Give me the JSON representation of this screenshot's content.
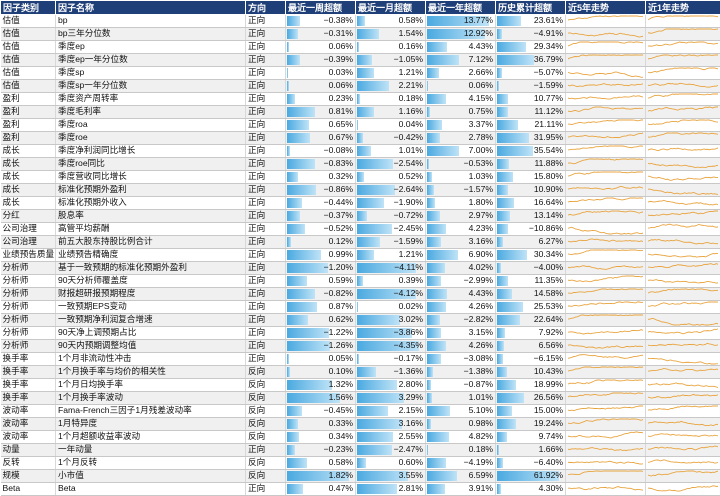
{
  "headers": [
    "因子类别",
    "因子名称",
    "方向",
    "最近一周超额",
    "最近一月超额",
    "最近一年超额",
    "历史累计超额",
    "近5年走势",
    "近1年走势"
  ],
  "colors": {
    "header_bg": "#1f3f78",
    "bar": "#4aa9e0",
    "spark": "#e8a33d"
  },
  "rows": [
    {
      "cat": "估值",
      "name": "bp",
      "dir": "正向",
      "w": -0.38,
      "m": 0.58,
      "y": 13.77,
      "h": 23.61
    },
    {
      "cat": "估值",
      "name": "bp三年分位数",
      "dir": "正向",
      "w": -0.31,
      "m": 1.54,
      "y": 12.92,
      "h": -4.91
    },
    {
      "cat": "估值",
      "name": "季度ep",
      "dir": "正向",
      "w": 0.06,
      "m": 0.16,
      "y": 4.43,
      "h": 29.34
    },
    {
      "cat": "估值",
      "name": "季度ep一年分位数",
      "dir": "正向",
      "w": -0.39,
      "m": -1.05,
      "y": 7.12,
      "h": 36.79
    },
    {
      "cat": "估值",
      "name": "季度sp",
      "dir": "正向",
      "w": 0.03,
      "m": 1.21,
      "y": 2.66,
      "h": -5.07
    },
    {
      "cat": "估值",
      "name": "季度sp一年分位数",
      "dir": "正向",
      "w": 0.06,
      "m": 2.21,
      "y": 0.06,
      "h": -1.59
    },
    {
      "cat": "盈利",
      "name": "季度资产周转率",
      "dir": "正向",
      "w": 0.23,
      "m": 0.18,
      "y": 4.15,
      "h": 10.77
    },
    {
      "cat": "盈利",
      "name": "季度毛利率",
      "dir": "正向",
      "w": 0.81,
      "m": 1.16,
      "y": 0.75,
      "h": 11.12
    },
    {
      "cat": "盈利",
      "name": "季度roa",
      "dir": "正向",
      "w": 0.65,
      "m": 0.04,
      "y": 3.37,
      "h": 21.11
    },
    {
      "cat": "盈利",
      "name": "季度roe",
      "dir": "正向",
      "w": 0.67,
      "m": -0.42,
      "y": 2.78,
      "h": 31.95
    },
    {
      "cat": "成长",
      "name": "季度净利润同比增长",
      "dir": "正向",
      "w": -0.08,
      "m": 1.01,
      "y": 7.0,
      "h": 35.54
    },
    {
      "cat": "成长",
      "name": "季度roe同比",
      "dir": "正向",
      "w": -0.83,
      "m": -2.54,
      "y": -0.53,
      "h": 11.88
    },
    {
      "cat": "成长",
      "name": "季度营收同比增长",
      "dir": "正向",
      "w": 0.32,
      "m": 0.52,
      "y": 1.03,
      "h": 15.8
    },
    {
      "cat": "成长",
      "name": "标准化预期外盈利",
      "dir": "正向",
      "w": -0.86,
      "m": -2.64,
      "y": -1.57,
      "h": 10.9
    },
    {
      "cat": "成长",
      "name": "标准化预期外收入",
      "dir": "正向",
      "w": -0.44,
      "m": -1.9,
      "y": 1.8,
      "h": 16.64
    },
    {
      "cat": "分红",
      "name": "股息率",
      "dir": "正向",
      "w": -0.37,
      "m": -0.72,
      "y": 2.97,
      "h": 13.14
    },
    {
      "cat": "公司治理",
      "name": "高管平均薪酬",
      "dir": "正向",
      "w": -0.52,
      "m": -2.45,
      "y": 4.23,
      "h": -10.86
    },
    {
      "cat": "公司治理",
      "name": "前五大股东持股比例合计",
      "dir": "正向",
      "w": 0.12,
      "m": -1.59,
      "y": 3.16,
      "h": 6.27
    },
    {
      "cat": "业绩预告质量",
      "name": "业绩预告精确度",
      "dir": "正向",
      "w": 0.99,
      "m": 1.21,
      "y": 6.9,
      "h": 30.34
    },
    {
      "cat": "分析师",
      "name": "基于一致预期的标准化预期外盈利",
      "dir": "正向",
      "w": -1.2,
      "m": -4.11,
      "y": 4.02,
      "h": -4.0
    },
    {
      "cat": "分析师",
      "name": "90天分析师覆盖度",
      "dir": "正向",
      "w": 0.59,
      "m": 0.39,
      "y": -2.99,
      "h": 11.35
    },
    {
      "cat": "分析师",
      "name": "财报超研报预期程度",
      "dir": "正向",
      "w": -0.82,
      "m": -4.12,
      "y": 4.43,
      "h": 14.58
    },
    {
      "cat": "分析师",
      "name": "一致预期EPS变动",
      "dir": "正向",
      "w": 0.87,
      "m": 0.02,
      "y": 4.26,
      "h": 25.53
    },
    {
      "cat": "分析师",
      "name": "一致预期净利润复合增速",
      "dir": "正向",
      "w": 0.62,
      "m": 3.02,
      "y": -2.82,
      "h": 22.64
    },
    {
      "cat": "分析师",
      "name": "90天净上调预期占比",
      "dir": "正向",
      "w": -1.22,
      "m": -3.86,
      "y": 3.15,
      "h": 7.92
    },
    {
      "cat": "分析师",
      "name": "90天内预期调整均值",
      "dir": "正向",
      "w": -1.26,
      "m": -4.35,
      "y": 4.26,
      "h": 6.56
    },
    {
      "cat": "换手率",
      "name": "1个月非流动性冲击",
      "dir": "正向",
      "w": 0.05,
      "m": -0.17,
      "y": -3.08,
      "h": -6.15
    },
    {
      "cat": "换手率",
      "name": "1个月换手率与均价的相关性",
      "dir": "反向",
      "w": 0.1,
      "m": -1.36,
      "y": -1.38,
      "h": 10.43
    },
    {
      "cat": "换手率",
      "name": "1个月日均换手率",
      "dir": "反向",
      "w": 1.32,
      "m": 2.8,
      "y": -0.87,
      "h": 18.99
    },
    {
      "cat": "换手率",
      "name": "1个月换手率波动",
      "dir": "反向",
      "w": 1.56,
      "m": 3.29,
      "y": 1.01,
      "h": 26.56
    },
    {
      "cat": "波动率",
      "name": "Fama-French三因子1月残差波动率",
      "dir": "反向",
      "w": -0.45,
      "m": 2.15,
      "y": 5.1,
      "h": 15.0
    },
    {
      "cat": "波动率",
      "name": "1月特异度",
      "dir": "反向",
      "w": 0.33,
      "m": 3.16,
      "y": 0.98,
      "h": 19.24
    },
    {
      "cat": "波动率",
      "name": "1个月超额收益率波动",
      "dir": "反向",
      "w": 0.34,
      "m": 2.55,
      "y": 4.82,
      "h": 9.74
    },
    {
      "cat": "动量",
      "name": "一年动量",
      "dir": "正向",
      "w": -0.23,
      "m": -2.47,
      "y": 0.18,
      "h": 1.66
    },
    {
      "cat": "反转",
      "name": "1个月反转",
      "dir": "反向",
      "w": 0.58,
      "m": 0.6,
      "y": -4.19,
      "h": -6.4
    },
    {
      "cat": "规模",
      "name": "小市值",
      "dir": "反向",
      "w": 1.82,
      "m": 3.55,
      "y": 6.59,
      "h": 61.92
    },
    {
      "cat": "Beta",
      "name": "Beta",
      "dir": "正向",
      "w": 0.47,
      "m": 2.81,
      "y": 3.91,
      "h": 4.3
    }
  ]
}
